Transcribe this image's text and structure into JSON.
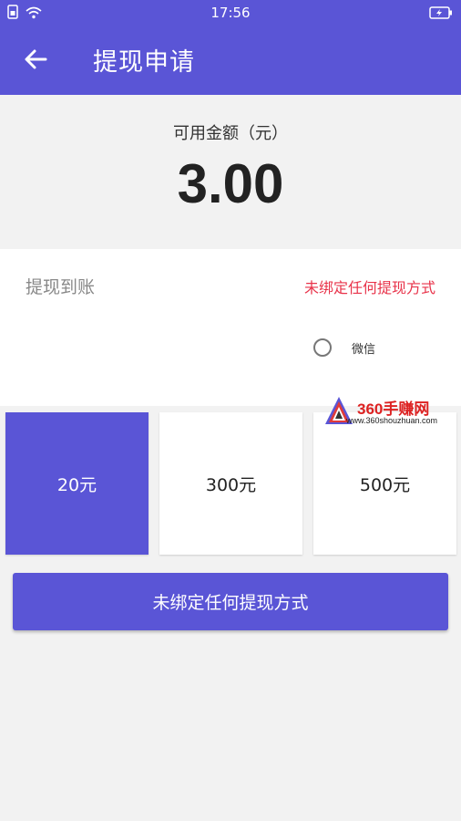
{
  "status_bar": {
    "time": "17:56",
    "icons": [
      "sim-icon",
      "wifi-icon",
      "battery-charging-icon"
    ]
  },
  "app_bar": {
    "title": "提现申请",
    "back_icon": "arrow-left-icon"
  },
  "balance": {
    "label": "可用金额（元）",
    "value": "3.00"
  },
  "withdraw_method": {
    "label": "提现到账",
    "status": "未绑定任何提现方式",
    "option_label": "微信",
    "option_selected": false
  },
  "amounts": [
    {
      "label": "20元",
      "selected": true
    },
    {
      "label": "300元",
      "selected": false
    },
    {
      "label": "500元",
      "selected": false
    }
  ],
  "watermark": {
    "title": "360手赚网",
    "url": "www.360shouzhuan.com"
  },
  "submit_button": {
    "label": "未绑定任何提现方式"
  },
  "colors": {
    "primary": "#5a55d6",
    "alert": "#e8334a",
    "background": "#f2f2f2"
  }
}
